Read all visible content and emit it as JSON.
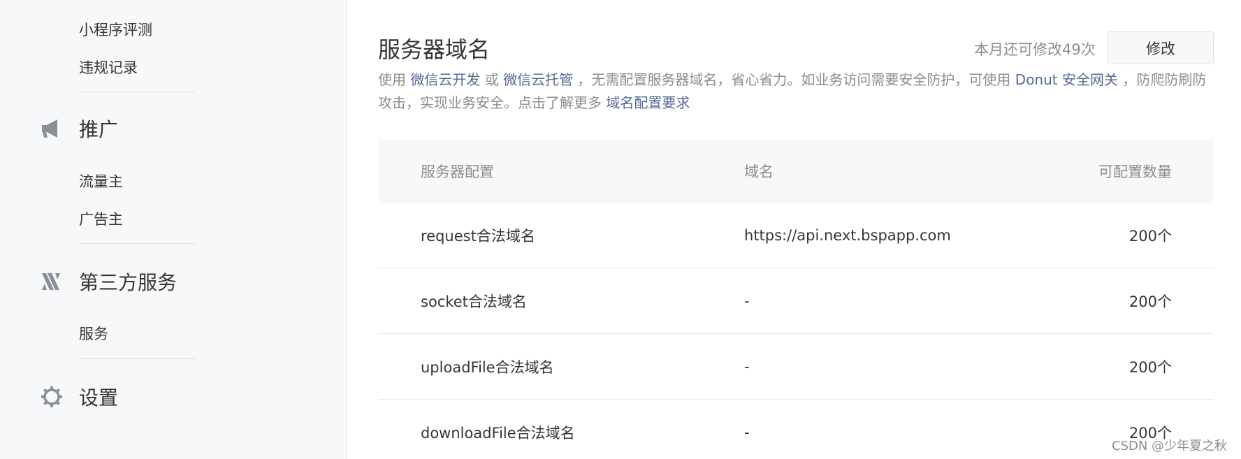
{
  "sidebar": {
    "top_items": [
      {
        "label": "小程序评测"
      },
      {
        "label": "违规记录"
      }
    ],
    "groups": [
      {
        "label": "推广",
        "icon": "megaphone-icon",
        "items": [
          {
            "label": "流量主"
          },
          {
            "label": "广告主"
          }
        ]
      },
      {
        "label": "第三方服务",
        "icon": "third-party-service-icon",
        "items": [
          {
            "label": "服务"
          }
        ]
      },
      {
        "label": "设置",
        "icon": "gear-icon",
        "items": []
      }
    ]
  },
  "main": {
    "title": "服务器域名",
    "quota_text": "本月还可修改49次",
    "edit_label": "修改",
    "description": {
      "p1": "使用 ",
      "link1": "微信云开发",
      "p2": " 或 ",
      "link2": "微信云托管",
      "p3": " ，无需配置服务器域名，省心省力。如业务访问需要安全防护，可使用 ",
      "link3": "Donut 安全网关",
      "p4": " ，防爬防刷防攻击，实现业务安全。点击了解更多 ",
      "link4": "域名配置要求"
    },
    "table": {
      "headers": {
        "config": "服务器配置",
        "domain": "域名",
        "count": "可配置数量"
      },
      "rows": [
        {
          "config": "request合法域名",
          "domain": "https://api.next.bspapp.com",
          "count": "200个"
        },
        {
          "config": "socket合法域名",
          "domain": "-",
          "count": "200个"
        },
        {
          "config": "uploadFile合法域名",
          "domain": "-",
          "count": "200个"
        },
        {
          "config": "downloadFile合法域名",
          "domain": "-",
          "count": "200个"
        }
      ]
    }
  },
  "watermark": "CSDN @少年夏之秋",
  "colors": {
    "link": "#576b95",
    "sidebar_bg": "#f6f8f9",
    "muted_text": "#8d8d8d",
    "text": "#353535"
  }
}
